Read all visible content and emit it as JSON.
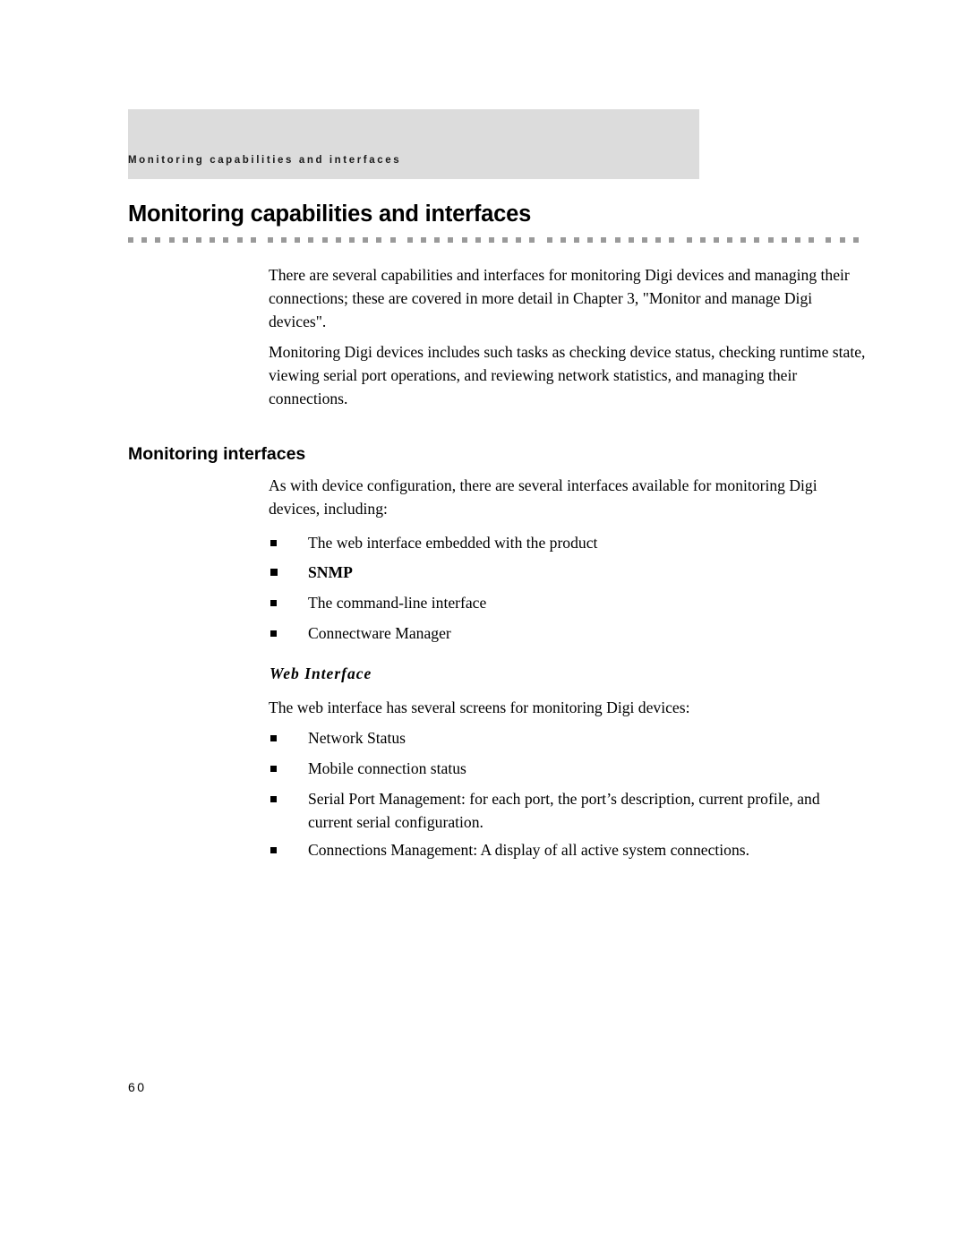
{
  "header": {
    "running_head": "Monitoring capabilities and interfaces"
  },
  "title": "Monitoring capabilities and interfaces",
  "intro": {
    "paragraph_1": "There are several capabilities and interfaces for monitoring Digi devices and managing their connections; these are covered in more detail in Chapter 3, \"Monitor and manage Digi devices\".",
    "paragraph_2": "Monitoring Digi devices includes such tasks as checking device status, checking runtime state, viewing serial port operations, and reviewing network statistics, and managing their connections."
  },
  "section_monitoring_interfaces": {
    "heading": "Monitoring interfaces",
    "paragraph": "As with device configuration, there are several interfaces available for monitoring Digi devices, including:",
    "bullets": [
      "The web interface embedded with the product",
      "SNMP",
      "The command-line interface",
      "Connectware Manager"
    ]
  },
  "section_web_interface": {
    "heading": "Web Interface",
    "paragraph": "The web interface has several screens for monitoring Digi devices:",
    "bullets": [
      "Network Status",
      "Mobile connection status",
      "Serial Port Management: for each port, the port’s description, current profile, and current serial configuration.",
      "Connections Management: A display of all active system connections."
    ]
  },
  "footer": {
    "page_number": "60"
  }
}
